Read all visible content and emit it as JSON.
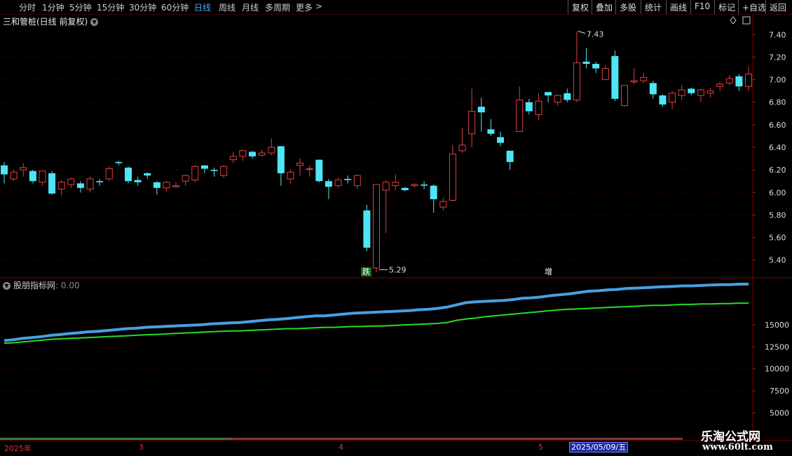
{
  "toolbar": {
    "periods": [
      "分时",
      "1分钟",
      "5分钟",
      "15分钟",
      "30分钟",
      "60分钟",
      "日线",
      "周线",
      "月线",
      "多周期",
      "更多"
    ],
    "active_period": "日线",
    "more_arrow": ">",
    "right_buttons": [
      "复权",
      "叠加",
      "多股",
      "统计",
      "画线",
      "F10",
      "标记",
      "+自选",
      "返回"
    ]
  },
  "main": {
    "stock_title": "三和管桩(日线 前复权)",
    "high_label": "7.43",
    "low_label": "5.29",
    "signal_down": "跌",
    "signal_up": "增",
    "price_ticks": [
      "7.40",
      "7.20",
      "7.00",
      "6.80",
      "6.60",
      "6.40",
      "6.20",
      "6.00",
      "5.80",
      "5.60",
      "5.40"
    ]
  },
  "indicator": {
    "name": "股朋指标网",
    "value": ": 0.00",
    "ticks": [
      "15000",
      "12500",
      "10000",
      "7500",
      "5000"
    ]
  },
  "dates": {
    "labels": [
      "2025年",
      "3",
      "4",
      "5"
    ],
    "selected": "2025/05/09/五"
  },
  "watermark": {
    "line1": "乐淘公式网",
    "line2": "www.60lt.com"
  },
  "colors": {
    "up": "#e04040",
    "down": "#4fe5f5",
    "line_blue": "#4a9fe0",
    "line_green": "#22dd22",
    "grid": "#3a0000"
  },
  "chart_data": {
    "type": "candlestick",
    "price_range": [
      5.28,
      7.52
    ],
    "indicator_range": [
      2500,
      20000
    ],
    "candles": [
      [
        6.24,
        6.16,
        6.27,
        6.08
      ],
      [
        6.12,
        6.18,
        6.2,
        6.1
      ],
      [
        6.2,
        6.22,
        6.26,
        6.14
      ],
      [
        6.19,
        6.1,
        6.2,
        6.08
      ],
      [
        6.09,
        6.19,
        6.19,
        6.06
      ],
      [
        6.17,
        5.99,
        6.19,
        5.98
      ],
      [
        6.03,
        6.09,
        6.11,
        5.97
      ],
      [
        6.07,
        6.12,
        6.13,
        6.04
      ],
      [
        6.08,
        6.04,
        6.1,
        6.0
      ],
      [
        6.03,
        6.12,
        6.14,
        6.0
      ],
      [
        6.1,
        6.09,
        6.12,
        6.06
      ],
      [
        6.12,
        6.21,
        6.23,
        6.1
      ],
      [
        6.27,
        6.26,
        6.28,
        6.24
      ],
      [
        6.22,
        6.1,
        6.23,
        6.08
      ],
      [
        6.11,
        6.09,
        6.14,
        6.06
      ],
      [
        6.17,
        6.15,
        6.18,
        6.12
      ],
      [
        6.09,
        6.04,
        6.1,
        5.98
      ],
      [
        6.04,
        6.09,
        6.1,
        6.01
      ],
      [
        6.05,
        6.06,
        6.09,
        6.04
      ],
      [
        6.1,
        6.15,
        6.16,
        6.06
      ],
      [
        6.11,
        6.23,
        6.24,
        6.09
      ],
      [
        6.24,
        6.21,
        6.24,
        6.17
      ],
      [
        6.2,
        6.19,
        6.22,
        6.14
      ],
      [
        6.15,
        6.23,
        6.24,
        6.13
      ],
      [
        6.29,
        6.32,
        6.36,
        6.26
      ],
      [
        6.32,
        6.37,
        6.38,
        6.28
      ],
      [
        6.36,
        6.32,
        6.37,
        6.3
      ],
      [
        6.33,
        6.35,
        6.38,
        6.32
      ],
      [
        6.35,
        6.4,
        6.48,
        6.33
      ],
      [
        6.41,
        6.17,
        6.41,
        6.06
      ],
      [
        6.12,
        6.18,
        6.2,
        6.08
      ],
      [
        6.24,
        6.26,
        6.3,
        6.15
      ],
      [
        6.21,
        6.21,
        6.24,
        6.14
      ],
      [
        6.29,
        6.1,
        6.29,
        6.09
      ],
      [
        6.1,
        6.05,
        6.12,
        5.94
      ],
      [
        6.06,
        6.11,
        6.13,
        6.04
      ],
      [
        6.12,
        6.11,
        6.15,
        6.08
      ],
      [
        6.06,
        6.15,
        6.16,
        6.03
      ],
      [
        5.84,
        5.51,
        5.89,
        5.48
      ],
      [
        5.33,
        6.07,
        6.07,
        5.29
      ],
      [
        6.02,
        6.09,
        6.11,
        5.64
      ],
      [
        6.06,
        6.09,
        6.16,
        6.02
      ],
      [
        6.04,
        6.02,
        6.05,
        6.01
      ],
      [
        6.06,
        6.07,
        6.08,
        6.04
      ],
      [
        6.07,
        6.06,
        6.1,
        6.03
      ],
      [
        6.06,
        5.94,
        6.07,
        5.82
      ],
      [
        5.87,
        5.92,
        5.95,
        5.84
      ],
      [
        5.93,
        6.34,
        6.42,
        5.92
      ],
      [
        6.37,
        6.42,
        6.57,
        6.35
      ],
      [
        6.52,
        6.72,
        6.92,
        6.4
      ],
      [
        6.76,
        6.71,
        6.84,
        6.54
      ],
      [
        6.56,
        6.52,
        6.65,
        6.5
      ],
      [
        6.49,
        6.44,
        6.54,
        6.41
      ],
      [
        6.37,
        6.27,
        6.37,
        6.2
      ],
      [
        6.54,
        6.82,
        6.94,
        6.54
      ],
      [
        6.8,
        6.72,
        6.83,
        6.69
      ],
      [
        6.69,
        6.81,
        6.88,
        6.64
      ],
      [
        6.89,
        6.86,
        6.89,
        6.8
      ],
      [
        6.8,
        6.86,
        6.87,
        6.77
      ],
      [
        6.88,
        6.82,
        6.92,
        6.8
      ],
      [
        6.82,
        7.15,
        7.43,
        6.8
      ],
      [
        7.16,
        7.14,
        7.28,
        7.1
      ],
      [
        7.14,
        7.1,
        7.16,
        7.06
      ],
      [
        7.0,
        7.1,
        7.13,
        7.0
      ],
      [
        7.21,
        6.83,
        7.26,
        6.81
      ],
      [
        6.77,
        6.95,
        6.95,
        6.76
      ],
      [
        6.98,
        6.99,
        7.1,
        6.96
      ],
      [
        6.99,
        7.02,
        7.06,
        6.97
      ],
      [
        6.97,
        6.87,
        6.99,
        6.83
      ],
      [
        6.86,
        6.78,
        6.87,
        6.76
      ],
      [
        6.8,
        6.88,
        6.9,
        6.74
      ],
      [
        6.86,
        6.91,
        6.95,
        6.82
      ],
      [
        6.92,
        6.88,
        6.93,
        6.86
      ],
      [
        6.86,
        6.91,
        6.92,
        6.8
      ],
      [
        6.88,
        6.9,
        6.93,
        6.84
      ],
      [
        6.94,
        6.96,
        6.98,
        6.9
      ],
      [
        6.97,
        7.01,
        7.04,
        6.95
      ],
      [
        7.03,
        6.94,
        7.05,
        6.9
      ],
      [
        6.94,
        7.05,
        7.12,
        6.9
      ]
    ],
    "series": [
      {
        "values": [
          13200,
          13300,
          13450,
          13550,
          13650,
          13800,
          13900,
          14000,
          14100,
          14200,
          14250,
          14350,
          14450,
          14550,
          14600,
          14700,
          14750,
          14800,
          14850,
          14900,
          14950,
          15000,
          15100,
          15150,
          15200,
          15250,
          15350,
          15450,
          15550,
          15600,
          15700,
          15800,
          15900,
          16000,
          16000,
          16100,
          16200,
          16300,
          16350,
          16400,
          16450,
          16500,
          16550,
          16600,
          16700,
          16750,
          16850,
          17000,
          17250,
          17500,
          17600,
          17650,
          17700,
          17750,
          17850,
          18000,
          18050,
          18150,
          18300,
          18400,
          18500,
          18650,
          18800,
          18850,
          18950,
          19000,
          19100,
          19150,
          19200,
          19250,
          19300,
          19350,
          19400,
          19400,
          19450,
          19500,
          19550,
          19550,
          19600,
          19600
        ]
      },
      {
        "values": [
          12900,
          12950,
          13050,
          13150,
          13250,
          13350,
          13400,
          13450,
          13500,
          13550,
          13600,
          13650,
          13700,
          13750,
          13800,
          13850,
          13900,
          13950,
          14000,
          14050,
          14100,
          14150,
          14200,
          14250,
          14300,
          14300,
          14350,
          14400,
          14450,
          14500,
          14550,
          14550,
          14600,
          14650,
          14700,
          14700,
          14750,
          14800,
          14800,
          14850,
          14850,
          14900,
          14950,
          15000,
          15050,
          15100,
          15150,
          15250,
          15500,
          15650,
          15750,
          15900,
          16000,
          16100,
          16200,
          16300,
          16400,
          16500,
          16600,
          16700,
          16750,
          16800,
          16850,
          16900,
          16950,
          17000,
          17050,
          17100,
          17150,
          17200,
          17200,
          17250,
          17300,
          17300,
          17350,
          17350,
          17400,
          17400,
          17450,
          17450
        ]
      }
    ]
  }
}
